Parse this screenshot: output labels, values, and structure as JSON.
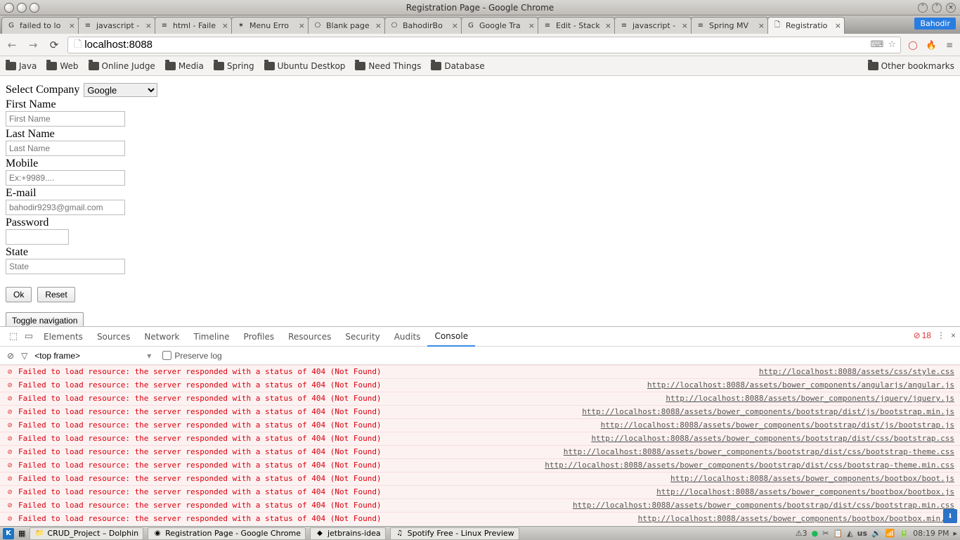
{
  "window": {
    "title": "Registration Page - Google Chrome",
    "user_badge": "Bahodir"
  },
  "tabs": [
    {
      "label": "failed to lo",
      "favicon": "G"
    },
    {
      "label": "javascript - ",
      "favicon": "≡"
    },
    {
      "label": "html - Faile",
      "favicon": "≡"
    },
    {
      "label": "Menu Erro",
      "favicon": "✶"
    },
    {
      "label": "Blank page",
      "favicon": "⎔"
    },
    {
      "label": "BahodirBo",
      "favicon": "⎔"
    },
    {
      "label": "Google Tra",
      "favicon": "G"
    },
    {
      "label": "Edit - Stack",
      "favicon": "≡"
    },
    {
      "label": "javascript - ",
      "favicon": "≡"
    },
    {
      "label": "Spring MV",
      "favicon": "≡"
    },
    {
      "label": "Registratio",
      "favicon": "🗋",
      "active": true
    }
  ],
  "omnibox": {
    "url": "localhost:8088"
  },
  "bookmarks": {
    "items": [
      "Java",
      "Web",
      "Online Judge",
      "Media",
      "Spring",
      "Ubuntu Destkop",
      "Need Things",
      "Database"
    ],
    "other": "Other bookmarks"
  },
  "form": {
    "company_label": "Select Company",
    "company_value": "Google",
    "first_name_label": "First Name",
    "first_name_placeholder": "First Name",
    "last_name_label": "Last Name",
    "last_name_placeholder": "Last Name",
    "mobile_label": "Mobile",
    "mobile_placeholder": "Ex:+9989....",
    "email_label": "E-mail",
    "email_placeholder": "bahodir9293@gmail.com",
    "password_label": "Password",
    "state_label": "State",
    "state_placeholder": "State",
    "ok": "Ok",
    "reset": "Reset",
    "toggle": "Toggle navigation"
  },
  "devtools": {
    "tabs": [
      "Elements",
      "Sources",
      "Network",
      "Timeline",
      "Profiles",
      "Resources",
      "Security",
      "Audits",
      "Console"
    ],
    "active_tab": "Console",
    "error_count": "18",
    "frame_selector": "<top frame>",
    "preserve_log": "Preserve log",
    "error_msg": "Failed to load resource: the server responded with a status of 404 (Not Found)",
    "sources": [
      "http://localhost:8088/assets/css/style.css",
      "http://localhost:8088/assets/bower_components/angularjs/angular.js",
      "http://localhost:8088/assets/bower_components/jquery/jquery.js",
      "http://localhost:8088/assets/bower_components/bootstrap/dist/js/bootstrap.min.js",
      "http://localhost:8088/assets/bower_components/bootstrap/dist/js/bootstrap.js",
      "http://localhost:8088/assets/bower_components/bootstrap/dist/css/bootstrap.css",
      "http://localhost:8088/assets/bower_components/bootstrap/dist/css/bootstrap-theme.css",
      "http://localhost:8088/assets/bower_components/bootstrap/dist/css/bootstrap-theme.min.css",
      "http://localhost:8088/assets/bower_components/bootbox/boot.js",
      "http://localhost:8088/assets/bower_components/bootbox/bootbox.js",
      "http://localhost:8088/assets/bower_components/bootstrap/dist/css/bootstrap.min.css",
      "http://localhost:8088/assets/bower_components/bootbox/bootbox.min.js"
    ]
  },
  "taskbar": {
    "items": [
      {
        "label": "CRUD_Project – Dolphin",
        "icon": "📁"
      },
      {
        "label": "Registration Page - Google Chrome",
        "icon": "◉"
      },
      {
        "label": "jetbrains-idea",
        "icon": "◆"
      },
      {
        "label": "Spotify Free - Linux Preview",
        "icon": "♫"
      }
    ],
    "clock": "08:19 PM"
  }
}
